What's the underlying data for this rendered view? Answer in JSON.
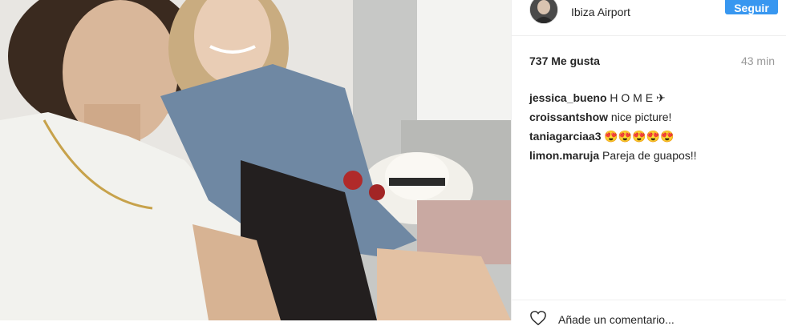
{
  "post": {
    "location": "Ibiza Airport",
    "follow_label": "Seguir",
    "likes": "737 Me gusta",
    "time": "43 min",
    "footer_text": "Añade un comentario..."
  },
  "comments": [
    {
      "user": "jessica_bueno",
      "text": "H O M E ✈"
    },
    {
      "user": "croissantshow",
      "text": "nice picture!"
    },
    {
      "user": "taniagarciaa3",
      "text": "😍😍😍😍😍"
    },
    {
      "user": "limon.maruja",
      "text": "Pareja de guapos!!"
    }
  ],
  "icons": {
    "avatar": "profile-avatar",
    "like": "heart-icon"
  },
  "colors": {
    "accent": "#3897f0",
    "muted": "#999999",
    "text": "#262626"
  }
}
